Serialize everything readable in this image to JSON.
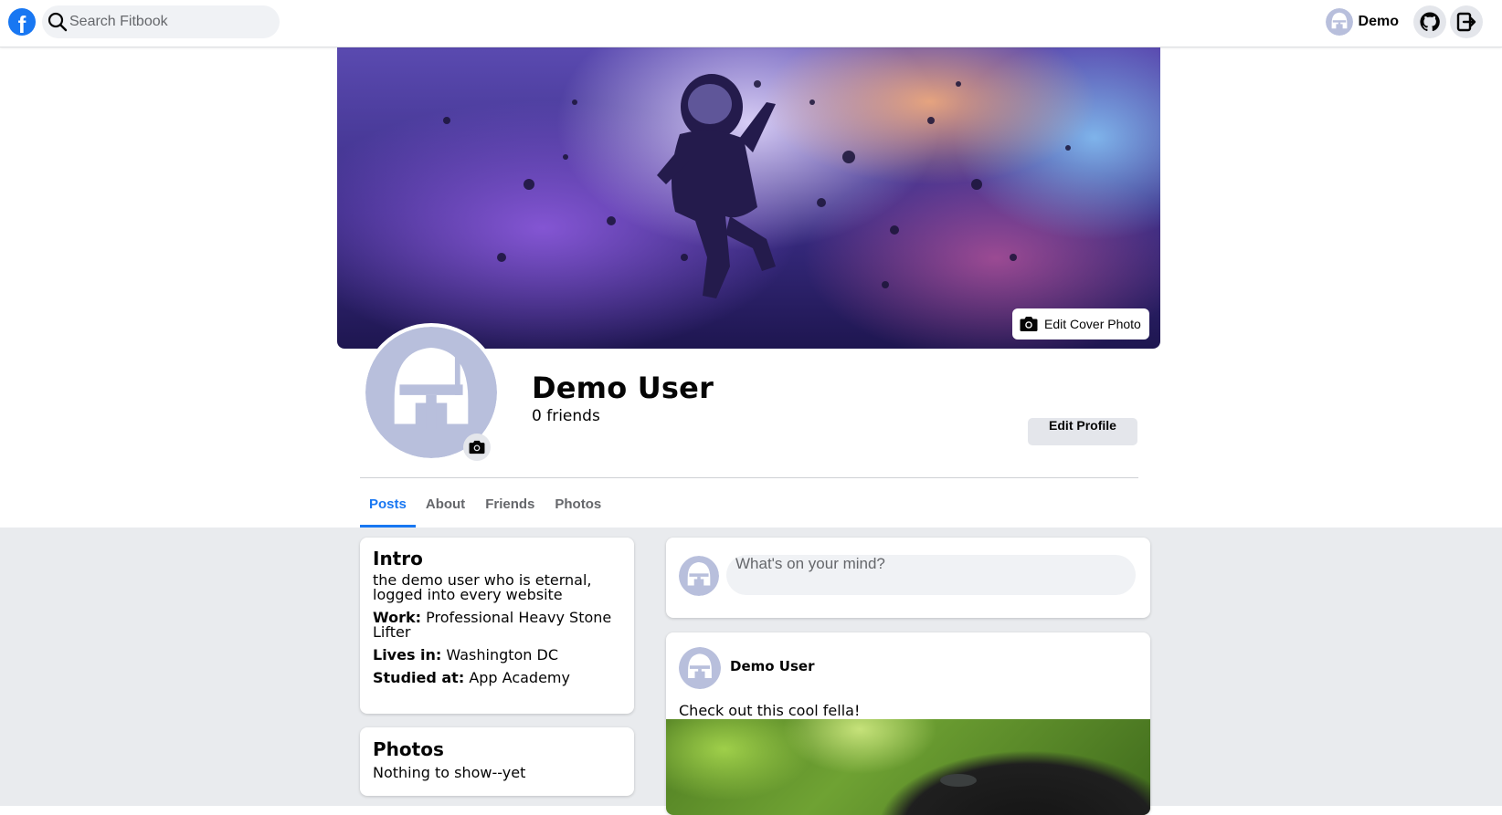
{
  "nav": {
    "logo_letter": "f",
    "search_placeholder": "Search Fitbook",
    "user_name": "Demo",
    "github_icon": "github-icon",
    "logout_icon": "logout-icon"
  },
  "profile": {
    "name": "Demo User",
    "friends": "0 friends",
    "edit_cover_label": "Edit Cover Photo",
    "edit_profile_label": "Edit Profile"
  },
  "tabs": [
    {
      "label": "Posts",
      "active": true
    },
    {
      "label": "About",
      "active": false
    },
    {
      "label": "Friends",
      "active": false
    },
    {
      "label": "Photos",
      "active": false
    }
  ],
  "intro": {
    "title": "Intro",
    "bio": "the demo user who is eternal, logged into every website",
    "work_label": "Work:",
    "work": "Professional Heavy Stone Lifter",
    "lives_label": "Lives in:",
    "lives": "Washington DC",
    "studied_label": "Studied at:",
    "studied": "App Academy"
  },
  "photos": {
    "title": "Photos",
    "empty": "Nothing to show--yet"
  },
  "composer": {
    "placeholder": "What's on your mind?"
  },
  "post": {
    "author": "Demo User",
    "text": "Check out this cool fella!"
  },
  "colors": {
    "accent": "#1877f2",
    "page_bg": "#e9ebee",
    "avatar_fill": "#b8bfdc"
  }
}
